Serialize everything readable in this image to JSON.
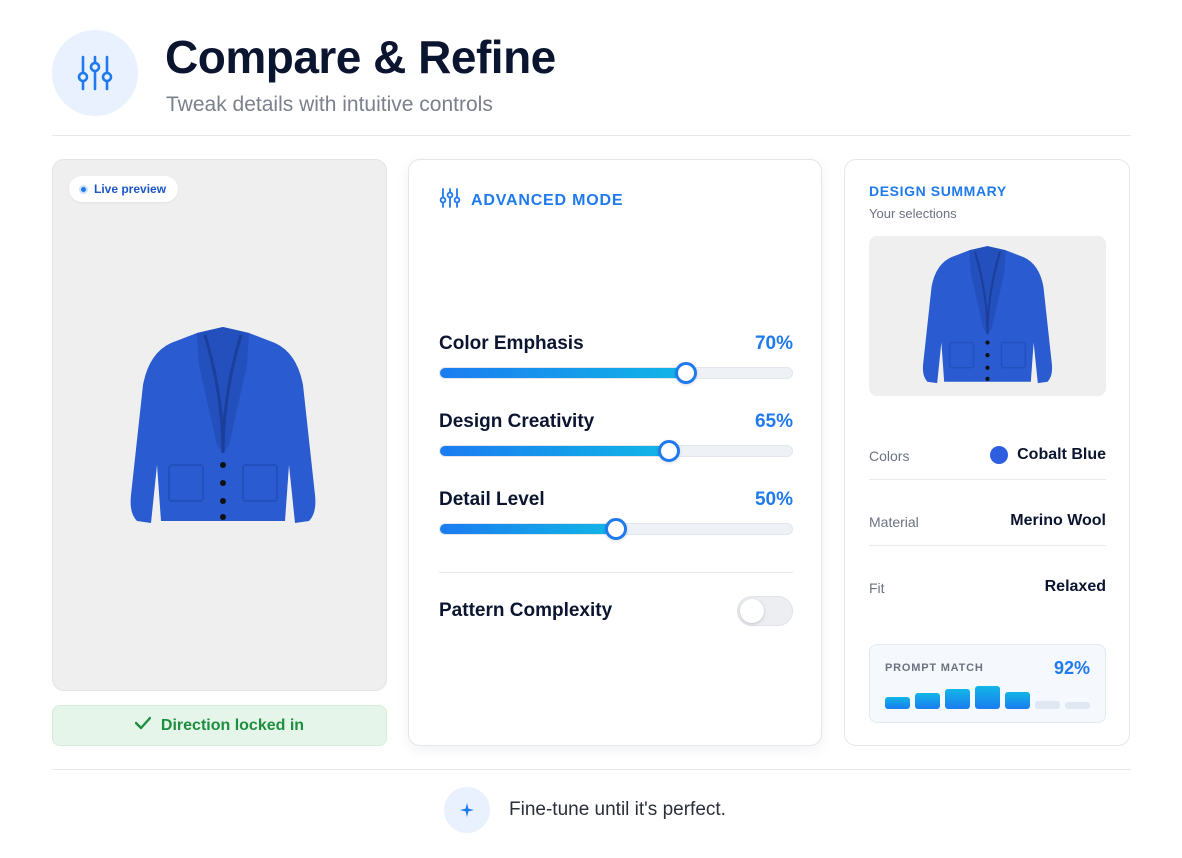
{
  "header": {
    "icon": "sliders-icon",
    "title": "Compare & Refine",
    "subtitle": "Tweak details with intuitive controls"
  },
  "preview": {
    "badge_label": "Live preview",
    "image": "blue-cardigan",
    "locked_label": "Direction locked in"
  },
  "controls": {
    "mode_label": "ADVANCED MODE",
    "sliders": [
      {
        "label": "Color Emphasis",
        "value_text": "70%",
        "value": 70
      },
      {
        "label": "Design Creativity",
        "value_text": "65%",
        "value": 65
      },
      {
        "label": "Detail Level",
        "value_text": "50%",
        "value": 50
      }
    ],
    "toggle": {
      "label": "Pattern Complexity",
      "on": false
    }
  },
  "summary": {
    "title": "DESIGN SUMMARY",
    "subtitle": "Your selections",
    "rows": [
      {
        "key": "Colors",
        "value": "Cobalt Blue",
        "swatch": "#2d5fe0"
      },
      {
        "key": "Material",
        "value": "Merino Wool"
      },
      {
        "key": "Fit",
        "value": "Relaxed"
      }
    ],
    "match": {
      "label": "PROMPT MATCH",
      "value_text": "92%",
      "bar_levels": [
        0.45,
        0.6,
        0.75,
        0.9,
        0.65,
        0.3,
        0.25
      ],
      "bar_active": [
        true,
        true,
        true,
        true,
        true,
        false,
        false
      ]
    }
  },
  "footer": {
    "icon": "sparkle-icon",
    "text": "Fine-tune until it's perfect."
  },
  "colors": {
    "accent": "#1f7aed",
    "success": "#1d8f3f",
    "cardigan": "#2a5bd0"
  }
}
